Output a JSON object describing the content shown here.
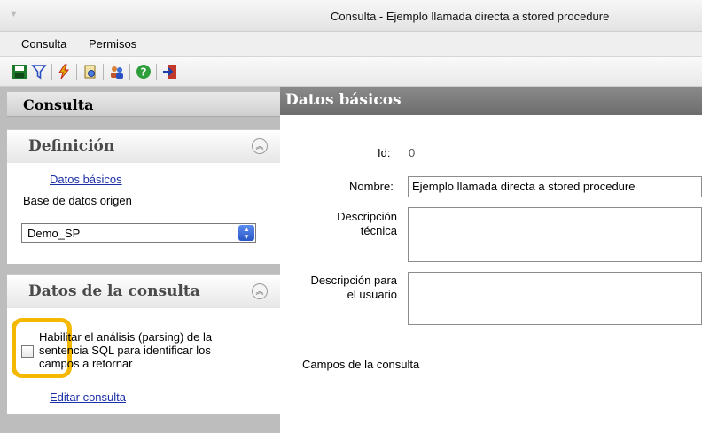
{
  "window": {
    "title": "Consulta - Ejemplo llamada directa a stored procedure"
  },
  "menu": {
    "items": [
      "Consulta",
      "Permisos"
    ]
  },
  "left": {
    "header": "Consulta",
    "definicion": {
      "title": "Definición",
      "link": "Datos básicos",
      "db_label": "Base de datos origen",
      "db_value": "Demo_SP"
    },
    "datos": {
      "title": "Datos de la consulta",
      "checkbox_label": "Habilitar el análisis (parsing) de la sentencia SQL para identificar los campos a retornar",
      "edit_link": "Editar consulta"
    }
  },
  "right": {
    "header": "Datos básicos",
    "id_label": "Id:",
    "id_value": "0",
    "nombre_label": "Nombre:",
    "nombre_value": "Ejemplo llamada directa a stored procedure",
    "desc_tecnica_label_1": "Descripción",
    "desc_tecnica_label_2": "técnica",
    "desc_usuario_label_1": "Descripción para",
    "desc_usuario_label_2": "el usuario",
    "campos_label": "Campos de la consulta"
  },
  "colors": {
    "highlight": "#f5b800",
    "link": "#1a2fa8"
  }
}
